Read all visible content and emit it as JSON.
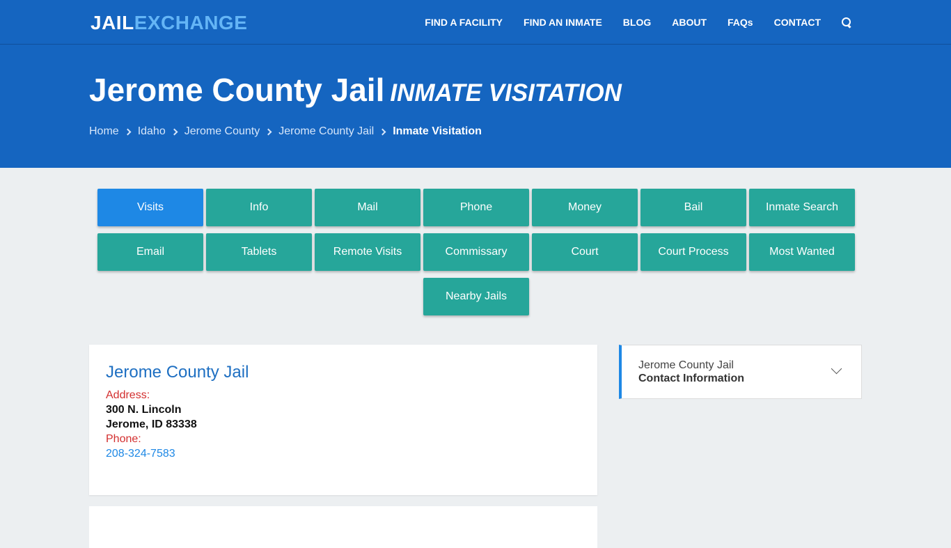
{
  "header": {
    "logo_part1": "JAIL",
    "logo_part2": "EXCHANGE",
    "nav": [
      "FIND A FACILITY",
      "FIND AN INMATE",
      "BLOG",
      "ABOUT",
      "FAQs",
      "CONTACT"
    ],
    "search_icon": "search-icon"
  },
  "hero": {
    "title": "Jerome County Jail",
    "subtitle": "INMATE VISITATION",
    "breadcrumb": [
      "Home",
      "Idaho",
      "Jerome County",
      "Jerome County Jail"
    ],
    "breadcrumb_current": "Inmate Visitation"
  },
  "buttons": {
    "row1": [
      "Visits",
      "Info",
      "Mail",
      "Phone",
      "Money",
      "Bail",
      "Inmate Search"
    ],
    "row2": [
      "Email",
      "Tablets",
      "Remote Visits",
      "Commissary",
      "Court",
      "Court Process",
      "Most Wanted"
    ],
    "row3": [
      "Nearby Jails"
    ],
    "active": "Visits"
  },
  "facility": {
    "name": "Jerome County Jail",
    "address_label": "Address:",
    "address_line1": "300 N. Lincoln",
    "address_line2": "Jerome, ID 83338",
    "phone_label": "Phone:",
    "phone": "208-324-7583"
  },
  "sidebar": {
    "line1": "Jerome County Jail",
    "line2": "Contact Information"
  },
  "colors": {
    "brand_blue": "#1565c0",
    "teal": "#26a69a",
    "active_blue": "#1e88e5",
    "label_red": "#d32f2f"
  }
}
